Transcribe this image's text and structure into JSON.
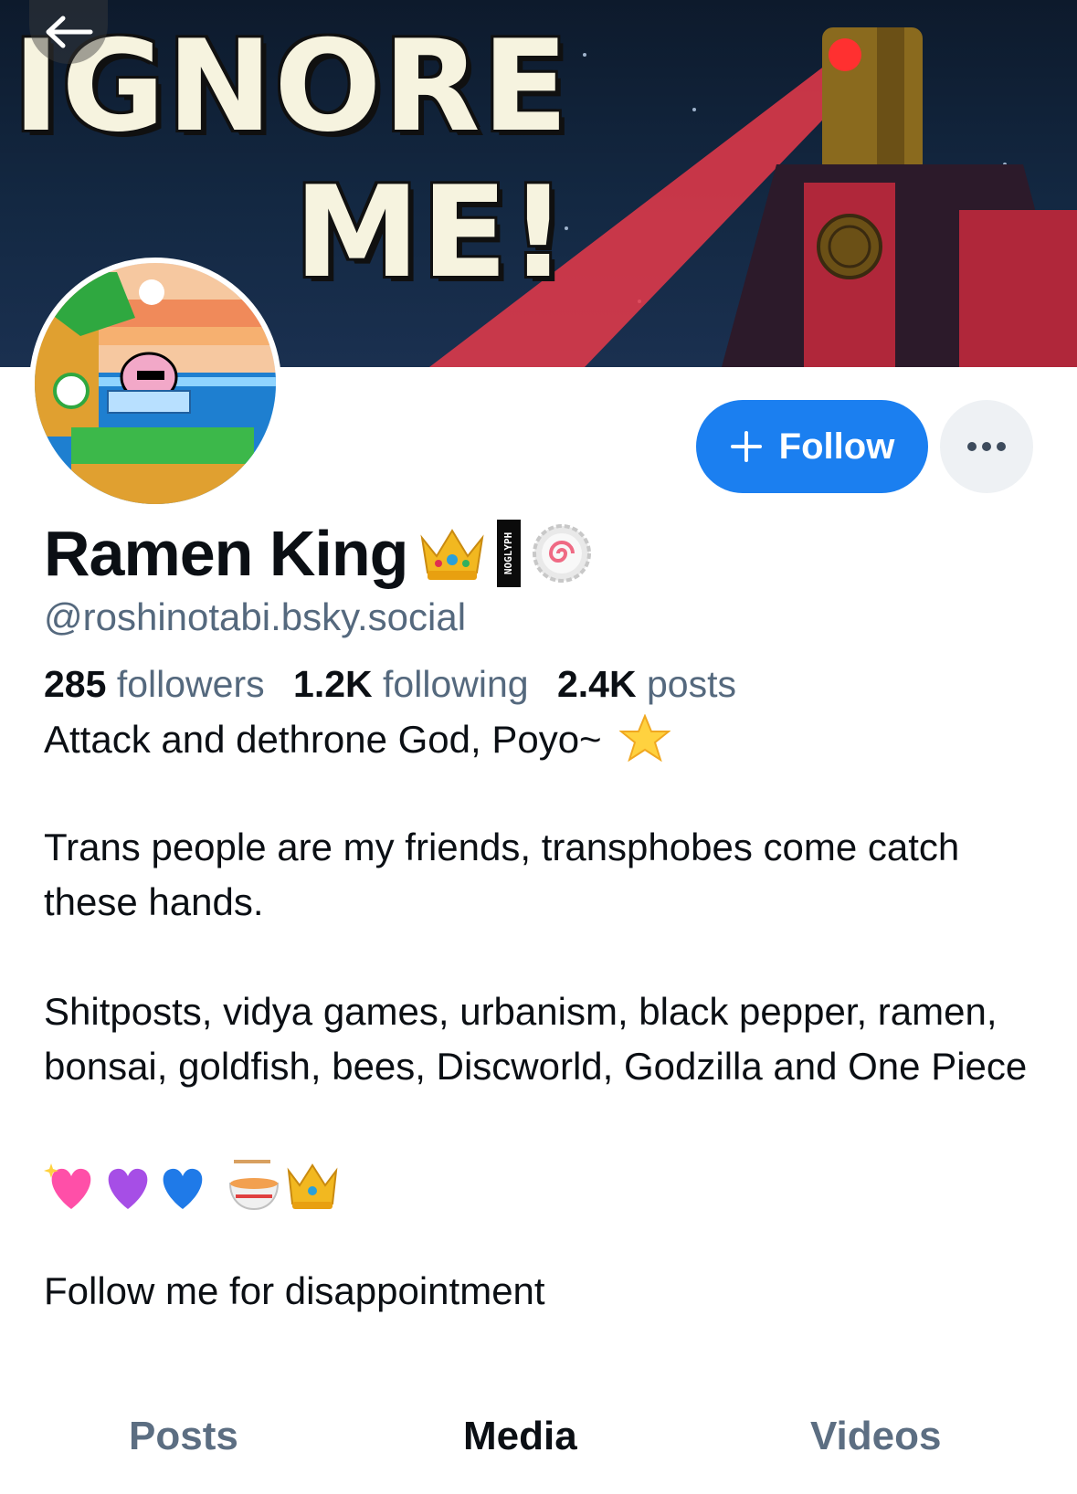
{
  "banner": {
    "line1": "IGNORE",
    "line2": "ME!"
  },
  "icons": {
    "back": "arrow-left-icon",
    "plus": "plus-icon",
    "more": "ellipsis-icon",
    "crown": "crown-emoji",
    "noglyph": "noglyph-badge",
    "naruto": "narutomaki-emoji",
    "star": "star-emoji",
    "hearts": [
      "sparkling-heart-emoji",
      "purple-heart-emoji",
      "blue-heart-emoji"
    ],
    "ramen": "ramen-bowl-emoji"
  },
  "profile": {
    "display_name": "Ramen King",
    "handle": "@roshinotabi.bsky.social",
    "noglyph_text": "NOGLYPH",
    "follow_label": "Follow",
    "stats": {
      "followers_count": "285",
      "followers_label": "followers",
      "following_count": "1.2K",
      "following_label": "following",
      "posts_count": "2.4K",
      "posts_label": "posts"
    },
    "bio": {
      "line1": "Attack and dethrone God, Poyo~",
      "line2": "Trans people are my friends, transphobes come catch these hands.",
      "line3": "Shitposts, vidya games, urbanism, black pepper, ramen, bonsai, goldfish, bees, Discworld, Godzilla and One Piece",
      "line4": "Follow me for disappointment"
    }
  },
  "tabs": [
    "Posts",
    "Media",
    "Videos"
  ],
  "active_tab": "Media",
  "colors": {
    "accent": "#1b7ff0",
    "muted_text": "#55697e",
    "primary_text": "#0b0f14"
  }
}
